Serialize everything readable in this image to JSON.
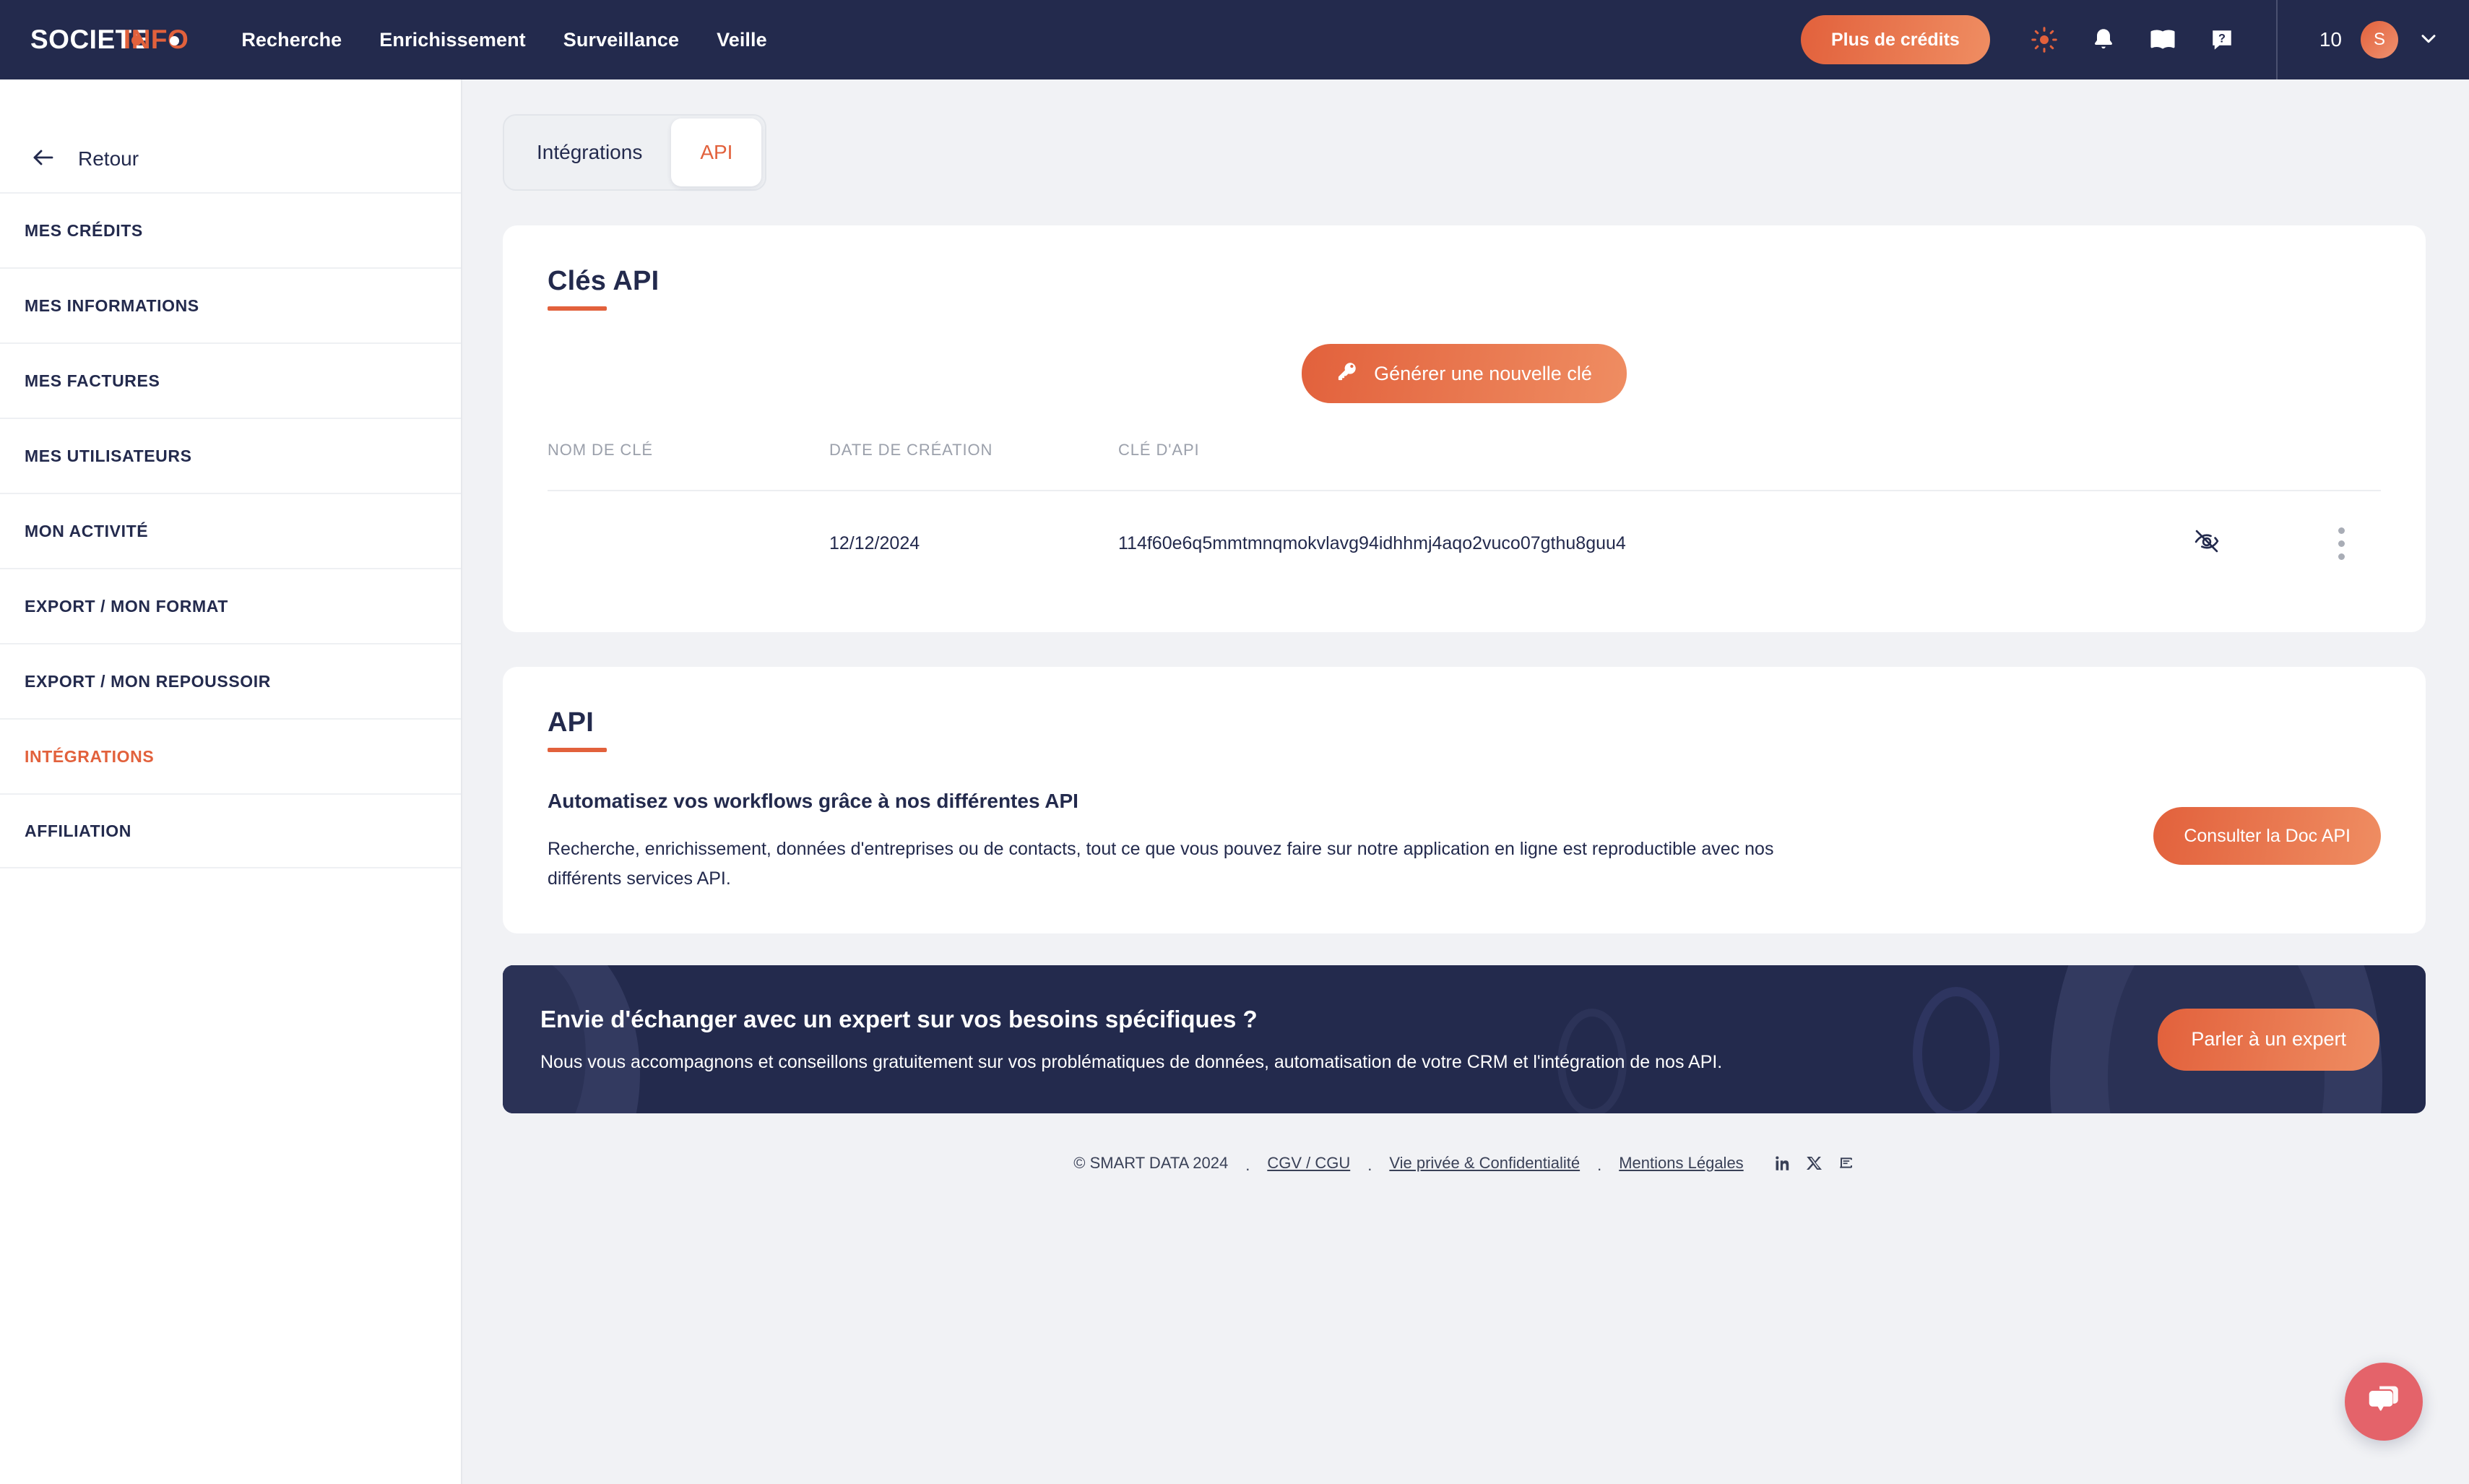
{
  "header": {
    "logo": {
      "part1": "SOCIETE",
      "part2": "INFO"
    },
    "nav": [
      {
        "label": "Recherche",
        "name": "nav-recherche"
      },
      {
        "label": "Enrichissement",
        "name": "nav-enrichissement"
      },
      {
        "label": "Surveillance",
        "name": "nav-surveillance"
      },
      {
        "label": "Veille",
        "name": "nav-veille"
      }
    ],
    "credits_button": "Plus de crédits",
    "icons": [
      "sun-icon",
      "bell-icon",
      "book-icon",
      "help-chat-icon"
    ],
    "credits_count": "10",
    "avatar_initial": "S",
    "accent_color": "#e2613c",
    "header_bg": "#232a4d"
  },
  "sidebar": {
    "back_label": "Retour",
    "items": [
      {
        "label": "MES CRÉDITS",
        "active": false
      },
      {
        "label": "MES INFORMATIONS",
        "active": false
      },
      {
        "label": "MES FACTURES",
        "active": false
      },
      {
        "label": "MES UTILISATEURS",
        "active": false
      },
      {
        "label": "MON ACTIVITÉ",
        "active": false
      },
      {
        "label": "EXPORT / MON FORMAT",
        "active": false
      },
      {
        "label": "EXPORT / MON REPOUSSOIR",
        "active": false
      },
      {
        "label": "INTÉGRATIONS",
        "active": true
      },
      {
        "label": "AFFILIATION",
        "active": false
      }
    ]
  },
  "tabs": [
    {
      "label": "Intégrations",
      "active": false
    },
    {
      "label": "API",
      "active": true
    }
  ],
  "keys_section": {
    "title": "Clés API",
    "generate_button": "Générer une nouvelle clé",
    "columns": [
      "NOM DE CLÉ",
      "DATE DE CRÉATION",
      "CLÉ D'API"
    ],
    "rows": [
      {
        "name": "",
        "date": "12/12/2024",
        "key": "114f60e6q5mmtmnqmokvlavg94idhhmj4aqo2vuco07gthu8guu4"
      }
    ]
  },
  "api_section": {
    "title": "API",
    "heading": "Automatisez vos workflows grâce à nos différentes API",
    "paragraph": "Recherche, enrichissement, données d'entreprises ou de contacts, tout ce que vous pouvez faire sur notre application en ligne est reproductible avec nos différents services API.",
    "doc_button": "Consulter la Doc API"
  },
  "expert_banner": {
    "title": "Envie d'échanger avec un expert sur vos besoins spécifiques ?",
    "subtitle": "Nous vous accompagnons et conseillons gratuitement sur vos problématiques de données, automatisation de votre CRM et l'intégration de nos API.",
    "button": "Parler à un expert",
    "bg_color": "#232a4d"
  },
  "footer": {
    "copyright": "© SMART DATA 2024",
    "separator": ".",
    "links": [
      "CGV / CGU",
      "Vie privée & Confidentialité",
      "Mentions Légales"
    ],
    "socials": [
      "linkedin-icon",
      "x-twitter-icon",
      "blog-icon"
    ]
  },
  "chat_widget": {
    "icon": "chat-bubbles-icon",
    "color": "#e4636a"
  }
}
